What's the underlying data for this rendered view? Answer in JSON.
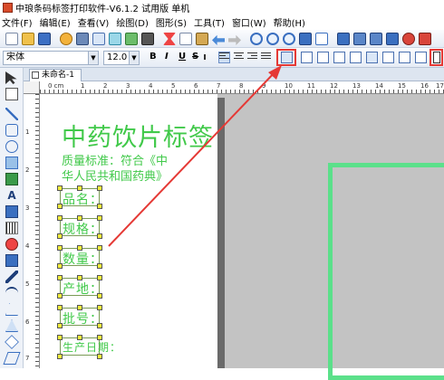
{
  "window": {
    "title": "中琅条码标签打印软件-V6.1.2 试用版 单机"
  },
  "menu": [
    "文件(F)",
    "编辑(E)",
    "查看(V)",
    "绘图(D)",
    "图形(S)",
    "工具(T)",
    "窗口(W)",
    "帮助(H)"
  ],
  "format_toolbar": {
    "font_name": "宋体",
    "font_size": "12.0",
    "bold": "B",
    "italic": "I",
    "underline": "U",
    "strike": "S"
  },
  "document_tab": {
    "label": "未命名-1 *"
  },
  "ruler": {
    "unit": "0 cm",
    "h_ticks": [
      "1",
      "2",
      "3",
      "4",
      "5",
      "6",
      "7",
      "8",
      "9",
      "10",
      "11",
      "12",
      "13",
      "14",
      "15",
      "16",
      "17"
    ],
    "v_ticks": [
      "1",
      "2",
      "3",
      "4",
      "5",
      "6",
      "7"
    ]
  },
  "label": {
    "title": "中药饮片标签",
    "standard_line1": "质量标准：符合《中",
    "standard_line2": "华人民共和国药典》",
    "fields": [
      "品名：",
      "规格：",
      "数量：",
      "产地：",
      "批号：",
      "生产日期："
    ]
  },
  "colors": {
    "label_text": "#41c94a",
    "highlight": "#e53935",
    "selection_handle": "#f4ef3c",
    "second_page_border": "#5be08a"
  }
}
